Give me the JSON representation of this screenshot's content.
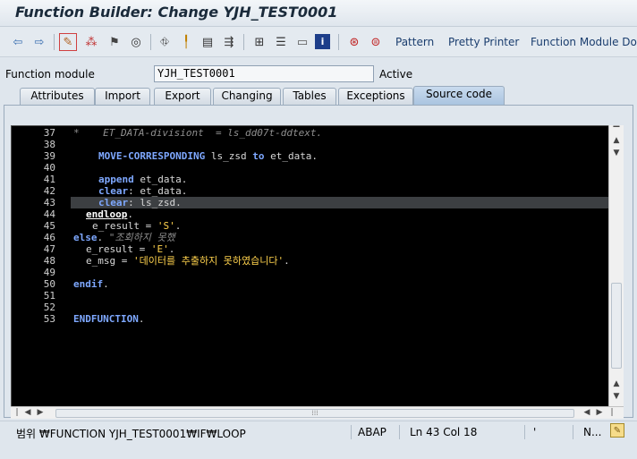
{
  "window": {
    "title": "Function Builder: Change YJH_TEST0001"
  },
  "toolbar": {
    "icons": [
      "back-arrow-icon",
      "forward-arrow-icon",
      "toggle-display-change-icon",
      "other-object-icon",
      "activate-icon",
      "check-icon",
      "test-icon",
      "where-used-icon",
      "navigation-window-icon",
      "display-object-list-icon",
      "module-icon",
      "enhance-icon",
      "help-icon",
      "breakpoint-icon",
      "session-breakpoint-icon"
    ],
    "pattern_label": "Pattern",
    "pretty_printer_label": "Pretty Printer",
    "fm_doc_label": "Function Module Docu"
  },
  "function_module": {
    "label": "Function module",
    "value": "YJH_TEST0001",
    "status": "Active"
  },
  "tabs": [
    {
      "label": "Attributes"
    },
    {
      "label": "Import"
    },
    {
      "label": "Export"
    },
    {
      "label": "Changing"
    },
    {
      "label": "Tables"
    },
    {
      "label": "Exceptions"
    },
    {
      "label": "Source code",
      "active": true
    }
  ],
  "editor": {
    "line_numbers": [
      "37",
      "38",
      "39",
      "40",
      "41",
      "42",
      "43",
      "44",
      "45",
      "46",
      "47",
      "48",
      "49",
      "50",
      "51",
      "52",
      "53"
    ],
    "lines": {
      "l37": "*    ET_DATA-divisiont  = ls_dd07t-ddtext.",
      "l39_kw": "MOVE-CORRESPONDING",
      "l39_rest": " ls_zsd ",
      "l39_kw2": "to",
      "l39_tail": " et_data.",
      "l41_kw": "append",
      "l41_rest": " et_data.",
      "l42_kw": "clear",
      "l42_rest": ": et_data.",
      "l43_kw": "clear",
      "l43_rest": ": ls_zsd.",
      "l44_kw": "endloop",
      "l44_rest": ".",
      "l45_rest": "e_result = ",
      "l45_str": "'S'",
      "l45_tail": ".",
      "l46_kw": "else",
      "l46_rest": ". ",
      "l46_cmt": "\"조회하지 못했",
      "l47_rest": "e_result = ",
      "l47_str": "'E'",
      "l47_tail": ".",
      "l48_rest": "e_msg = ",
      "l48_str": "'데이터를 추출하지 못하였습니다'",
      "l48_tail": ".",
      "l50_kw": "endif",
      "l50_rest": ".",
      "l53_kw": "ENDFUNCTION",
      "l53_rest": "."
    }
  },
  "status": {
    "scope": "범위 ₩FUNCTION YJH_TEST0001₩IF₩LOOP",
    "language": "ABAP",
    "position": "Ln  43 Col  18",
    "mode": "N..."
  }
}
